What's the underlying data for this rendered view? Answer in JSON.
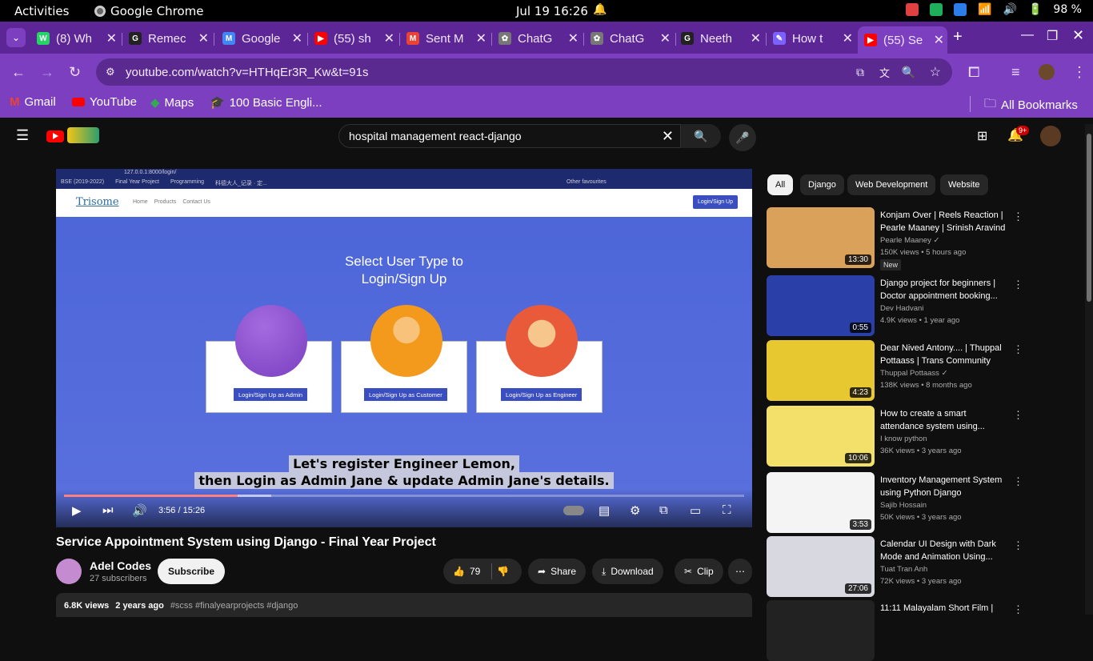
{
  "os": {
    "activities": "Activities",
    "app": "Google Chrome",
    "clock": "Jul 19  16:26",
    "battery": "98 %"
  },
  "tabs": [
    {
      "title": "(8) Wh",
      "color": "#25d366",
      "glyph": "W"
    },
    {
      "title": "Remec",
      "color": "#222",
      "glyph": "G"
    },
    {
      "title": "Google",
      "color": "#4285f4",
      "glyph": "M"
    },
    {
      "title": "(55) sh",
      "color": "#f00",
      "glyph": "▶"
    },
    {
      "title": "Sent M",
      "color": "#ea4335",
      "glyph": "M"
    },
    {
      "title": "ChatG",
      "color": "#777",
      "glyph": "✿"
    },
    {
      "title": "ChatG",
      "color": "#777",
      "glyph": "✿"
    },
    {
      "title": "Neeth",
      "color": "#222",
      "glyph": "G"
    },
    {
      "title": "How t",
      "color": "#7b61ff",
      "glyph": "✎"
    },
    {
      "title": "(55) Se",
      "color": "#f00",
      "glyph": "▶"
    }
  ],
  "url": "youtube.com/watch?v=HTHqEr3R_Kw&t=91s",
  "bookmarks": {
    "gmail": "Gmail",
    "youtube": "YouTube",
    "maps": "Maps",
    "english": "100 Basic Engli...",
    "all": "All Bookmarks"
  },
  "yt": {
    "search": "hospital management react-django",
    "notif": "9+",
    "video": {
      "inner_url": "127.0.0.1:8000/login/",
      "inner_bookmarks": [
        "BSE (2019-2022)",
        "Final Year Project",
        "Programming",
        "科德大人_记录 · 定...",
        "Other favourites"
      ],
      "site_brand": "Trisome",
      "site_nav": [
        "Home",
        "Products",
        "Contact Us"
      ],
      "site_login": "Login/Sign Up",
      "heading1": "Select User Type to",
      "heading2": "Login/Sign Up",
      "cards": [
        "Login/Sign Up as Admin",
        "Login/Sign Up as Customer",
        "Login/Sign Up as Engineer"
      ],
      "sub1": "Let's register Engineer Lemon,",
      "sub2": "then Login as Admin Jane & update Admin Jane's details.",
      "time": "3:56 / 15:26",
      "progress": 0.255
    },
    "title": "Service Appointment System using Django - Final Year Project",
    "channel": "Adel Codes",
    "subs": "27 subscribers",
    "subscribe": "Subscribe",
    "likes": "79",
    "share": "Share",
    "download": "Download",
    "clip": "Clip",
    "views": "6.8K views",
    "age": "2 years ago",
    "tags": "#scss #finalyearprojects #django",
    "chips": [
      "All",
      "Django",
      "Web Development",
      "Website"
    ],
    "recs": [
      {
        "title": "Konjam Over | Reels Reaction | Pearle Maaney | Srinish Aravind",
        "channel": "Pearle Maaney ✓",
        "meta": "150K views  •  5 hours ago",
        "dur": "13:30",
        "new": "New",
        "bg": "#d9a15a"
      },
      {
        "title": "Django project for beginners | Doctor appointment booking...",
        "channel": "Dev Hadvani",
        "meta": "4.9K views  •  1 year ago",
        "dur": "0:55",
        "new": "",
        "bg": "#2b3fa8"
      },
      {
        "title": "Dear Nived Antony.... | Thuppal Pottaass | Trans Community",
        "channel": "Thuppal Pottaass ✓",
        "meta": "138K views  •  8 months ago",
        "dur": "4:23",
        "new": "",
        "bg": "#e8c830"
      },
      {
        "title": "How to create a smart attendance system using...",
        "channel": "I know python",
        "meta": "36K views  •  3 years ago",
        "dur": "10:06",
        "new": "",
        "bg": "#f3e06a"
      },
      {
        "title": "Inventory Management System using Python Django",
        "channel": "Sajib Hossain",
        "meta": "50K views  •  3 years ago",
        "dur": "3:53",
        "new": "",
        "bg": "#f4f4f4"
      },
      {
        "title": "Calendar UI Design with Dark Mode and Animation Using...",
        "channel": "Tuat Tran Anh",
        "meta": "72K views  •  3 years ago",
        "dur": "27:06",
        "new": "",
        "bg": "#d8d8e0"
      },
      {
        "title": "11:11 Malayalam Short Film |",
        "channel": "",
        "meta": "",
        "dur": "",
        "new": "",
        "bg": "#222"
      }
    ]
  }
}
